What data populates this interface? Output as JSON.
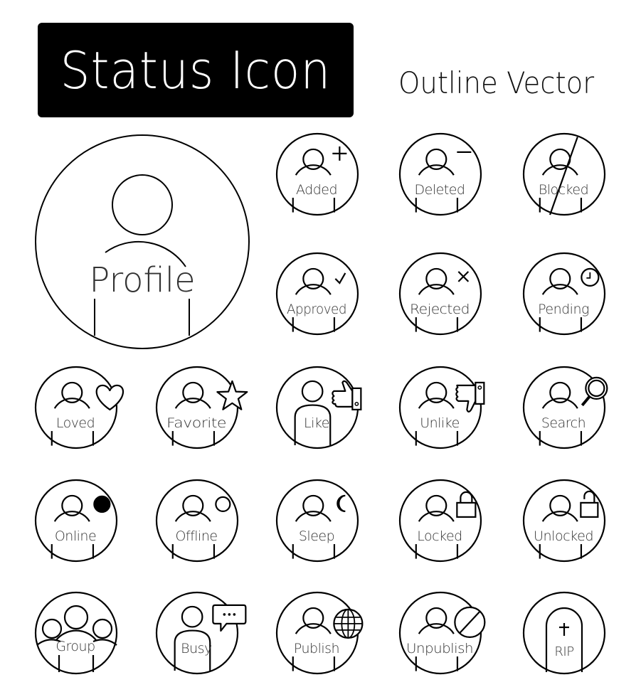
{
  "header": {
    "title": "Status Icon",
    "subtitle": "Outline Vector"
  },
  "colors": {
    "stroke": "#000000",
    "label": "#333333",
    "title_background": "#000000",
    "title_text": "#ffffff"
  },
  "profile": {
    "label": "Profile",
    "icon": "profile-icon"
  },
  "icons": [
    {
      "label": "Added",
      "badge": "plus-icon",
      "body": "outline"
    },
    {
      "label": "Deleted",
      "badge": "minus-icon",
      "body": "outline"
    },
    {
      "label": "Blocked",
      "badge": "slash-icon",
      "body": "outline"
    },
    {
      "label": "Approved",
      "badge": "checkmark-icon",
      "body": "outline"
    },
    {
      "label": "Rejected",
      "badge": "x-icon",
      "body": "outline"
    },
    {
      "label": "Pending",
      "badge": "clock-icon",
      "body": "outline"
    },
    {
      "label": "Loved",
      "badge": "heart-icon",
      "body": "outline"
    },
    {
      "label": "Favorite",
      "badge": "star-icon",
      "body": "outline"
    },
    {
      "label": "Like",
      "badge": "thumbs-up-hand-icon",
      "body": "arch"
    },
    {
      "label": "Unlike",
      "badge": "thumbs-down-hand-icon",
      "body": "outline"
    },
    {
      "label": "Search",
      "badge": "magnifier-icon",
      "body": "outline"
    },
    {
      "label": "Online",
      "badge": "filled-dot-icon",
      "body": "outline"
    },
    {
      "label": "Offline",
      "badge": "empty-dot-icon",
      "body": "outline"
    },
    {
      "label": "Sleep",
      "badge": "moon-icon",
      "body": "outline"
    },
    {
      "label": "Locked",
      "badge": "lock-closed-icon",
      "body": "outline"
    },
    {
      "label": "Unlocked",
      "badge": "lock-open-icon",
      "body": "outline"
    },
    {
      "label": "Group",
      "badge": "group-icon",
      "body": "group"
    },
    {
      "label": "Busy",
      "badge": "speech-bubble-icon",
      "body": "arch"
    },
    {
      "label": "Publish",
      "badge": "globe-icon",
      "body": "outline"
    },
    {
      "label": "Unpublish",
      "badge": "prohibited-icon",
      "body": "outline"
    },
    {
      "label": "RIP",
      "badge": "tombstone-icon",
      "body": "tomb"
    }
  ]
}
